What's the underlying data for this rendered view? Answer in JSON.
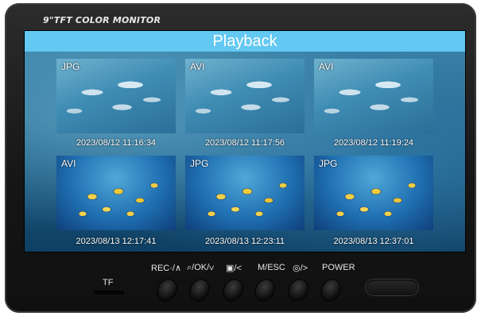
{
  "device": {
    "brand_label": "9\"TFT COLOR MONITOR"
  },
  "screen": {
    "title": "Playback",
    "thumbnails": [
      {
        "type": "JPG",
        "timestamp": "2023/08/12 11:16:34",
        "scene": "dolphins",
        "selected": true
      },
      {
        "type": "AVI",
        "timestamp": "2023/08/12 11:17:56",
        "scene": "dolphins",
        "selected": false
      },
      {
        "type": "AVI",
        "timestamp": "2023/08/12 11:19:24",
        "scene": "dolphins",
        "selected": false
      },
      {
        "type": "AVI",
        "timestamp": "2023/08/13 12:17:41",
        "scene": "fish",
        "selected": false
      },
      {
        "type": "JPG",
        "timestamp": "2023/08/13 12:23:11",
        "scene": "fish",
        "selected": false
      },
      {
        "type": "JPG",
        "timestamp": "2023/08/13 12:37:01",
        "scene": "fish",
        "selected": false
      }
    ],
    "selection_color": "#d8382f",
    "title_bar_color": "#63c8f2"
  },
  "controls": {
    "tf_label": "TF",
    "buttons": [
      {
        "label": "REC·/∧",
        "icon": "record-icon"
      },
      {
        "label": "⌕/OK/∨",
        "icon": "zoom-icon"
      },
      {
        "label": "▣/<",
        "icon": "gallery-icon"
      },
      {
        "label": "M/ESC",
        "icon": "menu-icon"
      },
      {
        "label": "◎/>",
        "icon": "camera-icon"
      },
      {
        "label": "POWER",
        "icon": "power-icon"
      }
    ]
  }
}
